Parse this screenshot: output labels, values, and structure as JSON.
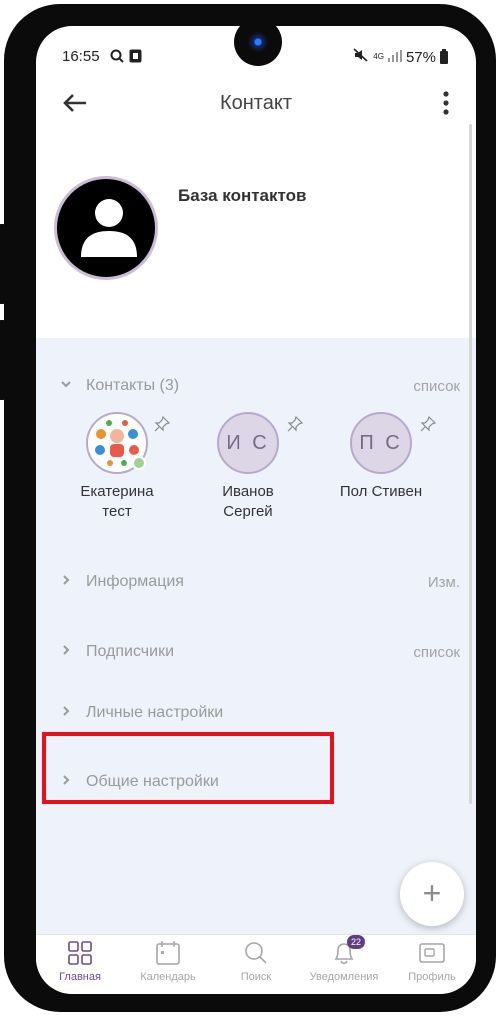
{
  "status_bar": {
    "time": "16:55",
    "network": "4G",
    "battery": "57%"
  },
  "header": {
    "title": "Контакт"
  },
  "profile": {
    "name": "База контактов"
  },
  "sections": {
    "contacts": {
      "label": "Контакты (3)",
      "action": "список"
    },
    "info": {
      "label": "Информация",
      "action": "Изм."
    },
    "subscribers": {
      "label": "Подписчики",
      "action": "список"
    },
    "personal": {
      "label": "Личные настройки"
    },
    "general": {
      "label": "Общие настройки"
    }
  },
  "contacts": [
    {
      "name_line1": "Екатерина",
      "name_line2": "тест",
      "initials": ""
    },
    {
      "name_line1": "Иванов",
      "name_line2": "Сергей",
      "initials": "И С"
    },
    {
      "name_line1": "Пол Стивен",
      "name_line2": "",
      "initials": "П С"
    }
  ],
  "fab": {
    "label": "+"
  },
  "bottom_nav": [
    {
      "label": "Главная",
      "icon": "grid-icon",
      "active": true
    },
    {
      "label": "Календарь",
      "icon": "calendar-icon"
    },
    {
      "label": "Поиск",
      "icon": "search-icon"
    },
    {
      "label": "Уведомления",
      "icon": "bell-icon",
      "badge": "22"
    },
    {
      "label": "Профиль",
      "icon": "profile-card-icon"
    }
  ],
  "colors": {
    "accent": "#5e3f86",
    "highlight_box": "#e8101a",
    "content_bg": "#eef2fb"
  }
}
